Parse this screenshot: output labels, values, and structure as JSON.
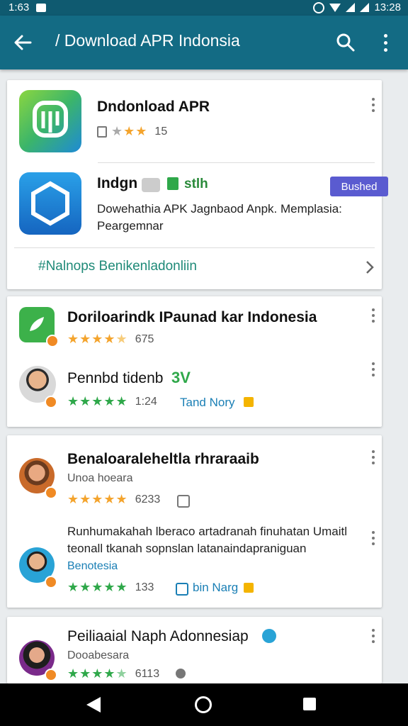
{
  "status": {
    "left_time": "1:63",
    "right_time": "13:28"
  },
  "appbar": {
    "title": "/ Download APR Indonsia"
  },
  "card1": {
    "app1": {
      "name": "Dndonload APR",
      "rating": "15"
    },
    "app2": {
      "name": "Indgn",
      "tag": "stlh",
      "button": "Bushed",
      "desc": "Dowehathia APK Jagnbaod Anpk. Memplasia: Peargemnar"
    },
    "footer": "#Nalnops Benikenladonliin"
  },
  "card2": {
    "item1": {
      "title": "Doriloarindk IPaunad kar Indonesia",
      "count": "675"
    },
    "item2": {
      "name": "Pennbd tidenb",
      "badge": "3V",
      "count": "1:24",
      "link": "Tand Nory"
    }
  },
  "card3": {
    "item1": {
      "title": "Benaloaraleheltla rhraraaib",
      "sub": "Unoa hoeara",
      "count": "6233"
    },
    "item2": {
      "desc": "Runhumakahah lberaco artadranah finuhatan Umaitl teonall tkanah sopnslan latanaindapraniguan",
      "sub": "Benotesia",
      "count": "133",
      "link": "bin Narg"
    }
  },
  "card4": {
    "item1": {
      "title": "Peiliaaial Naph Adonnesiap",
      "sub": "Dooabesara",
      "count": "6113"
    }
  },
  "colors": {
    "appbar": "#136b84",
    "star": "#f4a42d",
    "star_green": "#2fa84a",
    "button": "#5a5bd0"
  },
  "icons": [
    "back-arrow-icon",
    "search-icon",
    "more-vert-icon",
    "chevron-right-icon",
    "home-icon",
    "back-icon",
    "recents-icon"
  ]
}
